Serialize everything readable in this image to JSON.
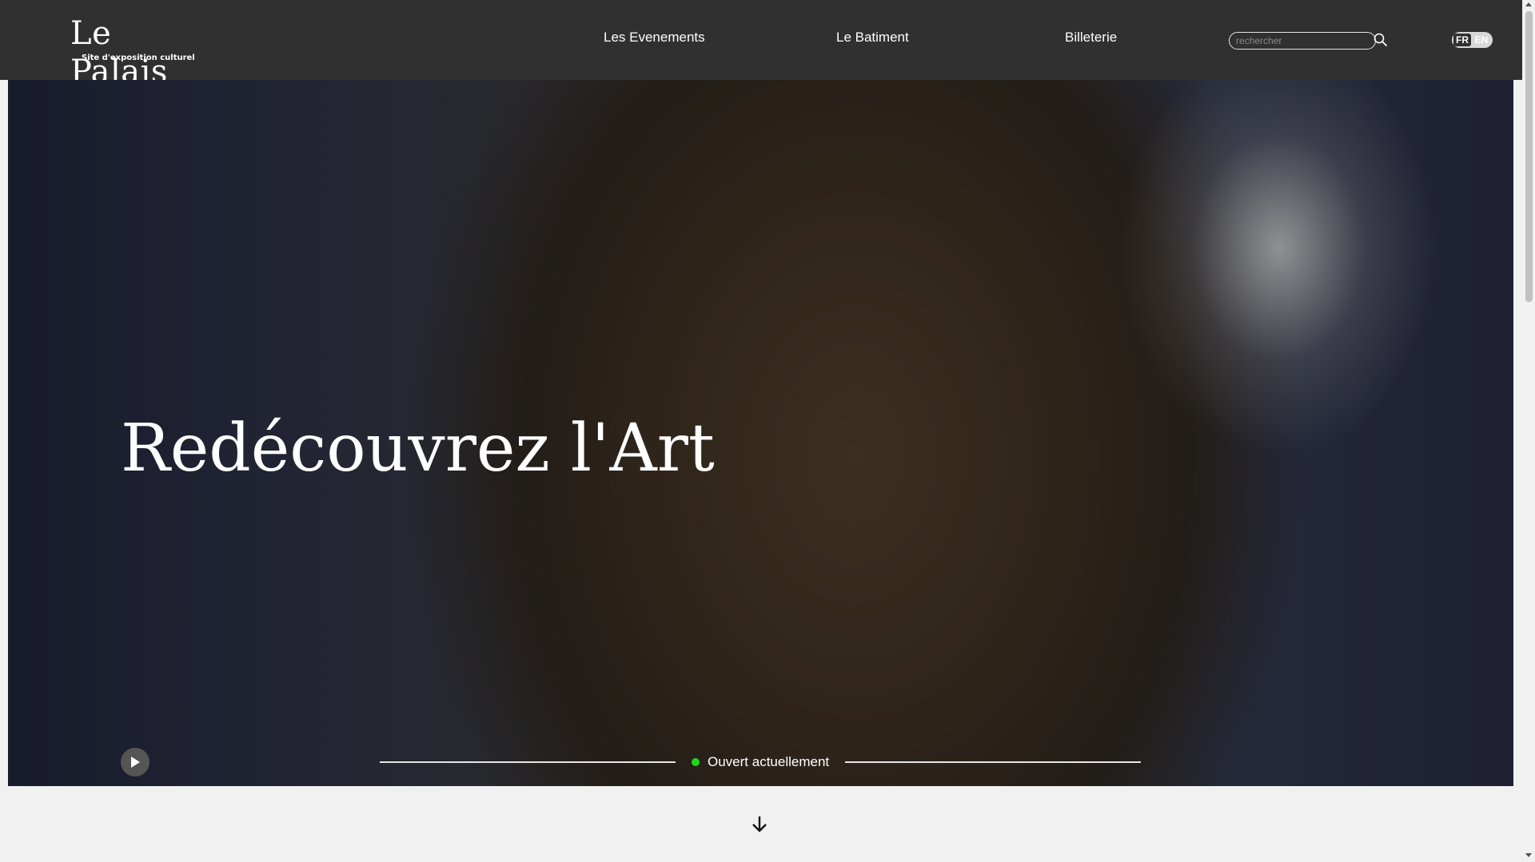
{
  "header": {
    "logo": {
      "name": "Le Palais",
      "tagline": "Site d'exposition culturel"
    },
    "nav": [
      {
        "label": "Les Evenements"
      },
      {
        "label": "Le Batiment"
      },
      {
        "label": "Billeterie"
      }
    ],
    "search": {
      "placeholder": "rechercher",
      "value": ""
    },
    "languages": {
      "active": "FR",
      "other": "EN"
    }
  },
  "hero": {
    "title": "Redécouvrez l'Art",
    "status": {
      "text": "Ouvert actuellement",
      "dot_color": "#1ed81e"
    }
  },
  "icons": [
    "search-icon",
    "play-icon",
    "arrow-down-icon"
  ],
  "colors": {
    "header_bg": "#303030",
    "page_bg": "#f1f1f1"
  }
}
